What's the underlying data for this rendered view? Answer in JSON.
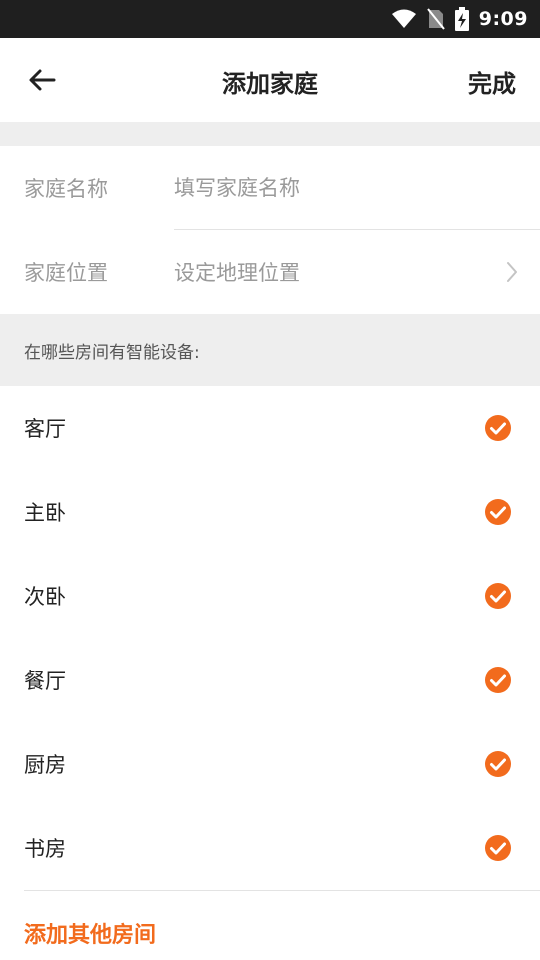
{
  "status_bar": {
    "time": "9:09"
  },
  "header": {
    "title": "添加家庭",
    "done_label": "完成",
    "back_icon": "arrow-left-icon"
  },
  "form": {
    "name_label": "家庭名称",
    "name_placeholder": "填写家庭名称",
    "location_label": "家庭位置",
    "location_value": "设定地理位置"
  },
  "rooms_section": {
    "header": "在哪些房间有智能设备:",
    "rooms": [
      {
        "label": "客厅",
        "checked": true
      },
      {
        "label": "主卧",
        "checked": true
      },
      {
        "label": "次卧",
        "checked": true
      },
      {
        "label": "餐厅",
        "checked": true
      },
      {
        "label": "厨房",
        "checked": true
      },
      {
        "label": "书房",
        "checked": true
      }
    ],
    "add_other": "添加其他房间"
  },
  "colors": {
    "accent": "#f26b1d",
    "status_bar": "#1f1f1f",
    "band": "#eeeeee"
  }
}
